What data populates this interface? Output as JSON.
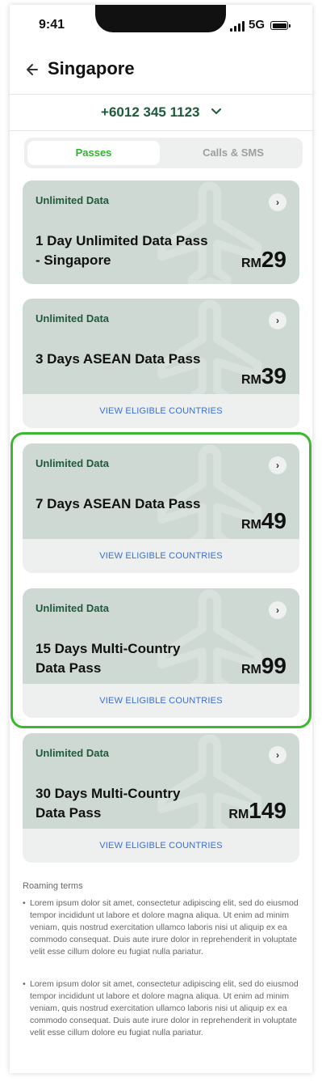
{
  "status_bar": {
    "time": "9:41",
    "network": "5G"
  },
  "header": {
    "title": "Singapore"
  },
  "phone": {
    "number": "+6012 345 1123"
  },
  "tabs": [
    {
      "label": "Passes",
      "active": true
    },
    {
      "label": "Calls & SMS",
      "active": false
    }
  ],
  "passes": [
    {
      "category": "Unlimited Data",
      "name": "1 Day Unlimited Data Pass - Singapore",
      "currency": "RM",
      "price": "29",
      "link": ""
    },
    {
      "category": "Unlimited Data",
      "name": "3 Days ASEAN Data Pass",
      "currency": "RM",
      "price": "39",
      "link": "VIEW ELIGIBLE COUNTRIES"
    },
    {
      "category": "Unlimited Data",
      "name": "7 Days ASEAN Data Pass",
      "currency": "RM",
      "price": "49",
      "link": "VIEW ELIGIBLE COUNTRIES"
    },
    {
      "category": "Unlimited Data",
      "name": "15 Days Multi-Country Data Pass",
      "currency": "RM",
      "price": "99",
      "link": "VIEW ELIGIBLE COUNTRIES"
    },
    {
      "category": "Unlimited Data",
      "name": "30 Days Multi-Country Data Pass",
      "currency": "RM",
      "price": "149",
      "link": "VIEW ELIGIBLE COUNTRIES"
    }
  ],
  "terms": {
    "title": "Roaming terms",
    "items": [
      "Lorem ipsum dolor sit amet, consectetur adipiscing elit, sed do eiusmod tempor incididunt ut labore et dolore magna aliqua. Ut enim ad minim veniam, quis nostrud exercitation ullamco laboris nisi ut aliquip ex ea commodo consequat. Duis aute irure dolor in reprehenderit in voluptate velit esse cillum dolore eu fugiat nulla pariatur.",
      "Lorem ipsum dolor sit amet, consectetur adipiscing elit, sed do eiusmod tempor incididunt ut labore et dolore magna aliqua. Ut enim ad minim veniam, quis nostrud exercitation ullamco laboris nisi ut aliquip ex ea commodo consequat. Duis aute irure dolor in reprehenderit in voluptate velit esse cillum dolore eu fugiat nulla pariatur."
    ]
  },
  "colors": {
    "accent": "#2fb52a",
    "brand_dark": "#1f5a3a",
    "link": "#3b6fd1",
    "card": "#cfd9d4",
    "highlight": "#3cb82f"
  },
  "icons": {
    "back": "arrow-left-icon",
    "dropdown": "chevron-down-icon",
    "card_arrow": "chevron-right-icon",
    "watermark": "airplane-icon"
  }
}
